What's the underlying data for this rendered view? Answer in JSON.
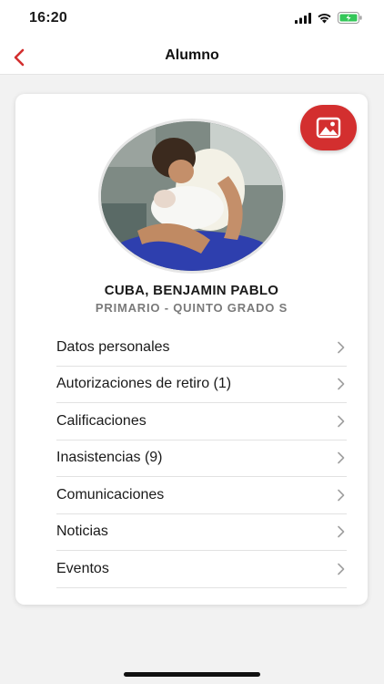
{
  "status_bar": {
    "time": "16:20"
  },
  "nav": {
    "title": "Alumno"
  },
  "student": {
    "name": "CUBA, BENJAMIN PABLO",
    "grade": "PRIMARIO - QUINTO GRADO S"
  },
  "menu": [
    {
      "label": "Datos personales"
    },
    {
      "label": "Autorizaciones de retiro (1)"
    },
    {
      "label": "Calificaciones"
    },
    {
      "label": "Inasistencias (9)"
    },
    {
      "label": "Comunicaciones"
    },
    {
      "label": "Noticias"
    },
    {
      "label": "Eventos"
    }
  ],
  "colors": {
    "accent": "#d32f2f",
    "battery": "#34c759"
  }
}
